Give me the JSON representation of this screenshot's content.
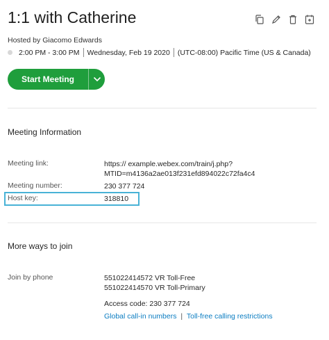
{
  "meeting": {
    "title": "1:1 with Catherine",
    "host": "Hosted by Giacomo Edwards",
    "time": "2:00 PM - 3:00 PM",
    "date": "Wednesday, Feb 19 2020",
    "timezone": "(UTC-08:00) Pacific Time (US & Canada)"
  },
  "actions": {
    "icons": [
      "copy-icon",
      "edit-icon",
      "trash-icon",
      "calendar-add-icon"
    ]
  },
  "start_button": {
    "label": "Start Meeting"
  },
  "info": {
    "heading": "Meeting Information",
    "link_label": "Meeting link:",
    "link_prefix": "https:// ",
    "link_host": "example",
    "link_rest": ".webex.com/train/j.php?",
    "link_line2": "MTID=m4136a2ae013f231efd894022c72fa4c4",
    "number_label": "Meeting number:",
    "number_value": "230 377 724",
    "hostkey_label": "Host key:",
    "hostkey_value": "318810"
  },
  "join": {
    "heading": "More ways to join",
    "phone_label": "Join by phone",
    "phone1": "551022414572 VR Toll-Free",
    "phone2": "551022414570 VR Toll-Primary",
    "access_code": "Access code: 230 377 724",
    "global_link": "Global call-in numbers",
    "link_separator": "|",
    "tollfree_link": "Toll-free calling restrictions"
  }
}
